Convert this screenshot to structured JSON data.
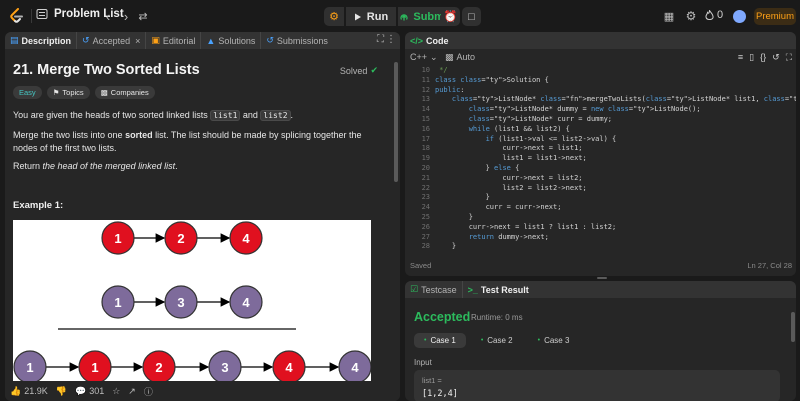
{
  "topbar": {
    "problem_list": "Problem List",
    "run": "Run",
    "submit": "Submit",
    "streak": "0",
    "premium": "Premium",
    "icons": [
      "list-icon",
      "chevron-left-icon",
      "chevron-right-icon",
      "shuffle-icon",
      "bug-icon",
      "play-icon",
      "upload-icon",
      "alarm-icon",
      "note-icon",
      "layout-icon",
      "gear-icon",
      "fire-icon",
      "avatar"
    ]
  },
  "left": {
    "tabs": [
      {
        "label": "Description",
        "icon": "description-icon"
      },
      {
        "label": "Accepted",
        "icon": "history-icon"
      },
      {
        "label": "Editorial",
        "icon": "book-icon"
      },
      {
        "label": "Solutions",
        "icon": "flask-icon"
      },
      {
        "label": "Submissions",
        "icon": "history-icon"
      }
    ],
    "title": "21. Merge Two Sorted Lists",
    "solved": "Solved",
    "difficulty": "Easy",
    "topics": "Topics",
    "companies": "Companies",
    "desc1_a": "You are given the heads of two sorted linked lists ",
    "desc1_code1": "list1",
    "desc1_b": " and ",
    "desc1_code2": "list2",
    "desc1_c": ".",
    "desc2_a": "Merge the two lists into one ",
    "desc2_bold": "sorted",
    "desc2_b": " list. The list should be made by splicing together the nodes of the first two lists.",
    "desc3_a": "Return ",
    "desc3_italic": "the head of the merged linked list",
    "desc3_b": ".",
    "example_title": "Example 1:",
    "diagram": {
      "row1": [
        "1",
        "2",
        "4"
      ],
      "row2": [
        "1",
        "3",
        "4"
      ],
      "row3": [
        "1",
        "1",
        "2",
        "3",
        "4",
        "4"
      ],
      "red": "#e0101f",
      "purple": "#7e6b9b"
    },
    "footer": {
      "likes": "21.9K",
      "comments": "301"
    }
  },
  "code": {
    "title": "Code",
    "language": "C++",
    "mode": "Auto",
    "lines": [
      {
        "n": "10",
        "t": " */"
      },
      {
        "n": "11",
        "t": "class Solution {"
      },
      {
        "n": "12",
        "t": "public:"
      },
      {
        "n": "13",
        "t": "    ListNode* mergeTwoLists(ListNode* list1, ListNode* list2) {"
      },
      {
        "n": "14",
        "t": "        ListNode* dummy = new ListNode();"
      },
      {
        "n": "15",
        "t": "        ListNode* curr = dummy;"
      },
      {
        "n": "16",
        "t": "        while (list1 && list2) {"
      },
      {
        "n": "17",
        "t": "            if (list1->val <= list2->val) {"
      },
      {
        "n": "18",
        "t": "                curr->next = list1;"
      },
      {
        "n": "19",
        "t": "                list1 = list1->next;"
      },
      {
        "n": "20",
        "t": "            } else {"
      },
      {
        "n": "21",
        "t": "                curr->next = list2;"
      },
      {
        "n": "22",
        "t": "                list2 = list2->next;"
      },
      {
        "n": "23",
        "t": "            }"
      },
      {
        "n": "24",
        "t": "            curr = curr->next;"
      },
      {
        "n": "25",
        "t": "        }"
      },
      {
        "n": "26",
        "t": "        curr->next = list1 ? list1 : list2;"
      },
      {
        "n": "27",
        "t": "        return dummy->next;"
      },
      {
        "n": "28",
        "t": "    }"
      }
    ],
    "status": "Saved",
    "cursor": "Ln 27, Col 28"
  },
  "test": {
    "tabs": [
      {
        "label": "Testcase",
        "icon": "checkbox-icon"
      },
      {
        "label": "Test Result",
        "icon": "terminal-icon"
      }
    ],
    "verdict": "Accepted",
    "runtime": "Runtime: 0 ms",
    "cases": [
      "Case 1",
      "Case 2",
      "Case 3"
    ],
    "input_label": "Input",
    "var": "list1 =",
    "value": "[1,2,4]"
  }
}
